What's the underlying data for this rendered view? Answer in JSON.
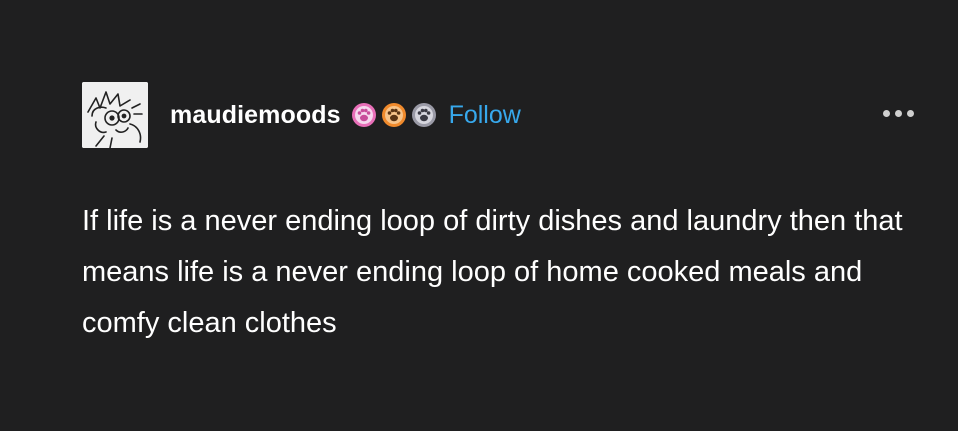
{
  "post": {
    "username": "maudiemoods",
    "follow_label": "Follow",
    "body": "If life is a never ending loop of dirty dishes and laundry then that means life is a never ending loop of home cooked meals and comfy clean clothes",
    "badges": [
      "pink-paw-badge",
      "orange-paw-badge",
      "gray-paw-badge"
    ],
    "more_icon": "ellipsis-icon",
    "colors": {
      "background": "#1f1f20",
      "follow": "#37a8ec",
      "text": "#ffffff"
    }
  }
}
